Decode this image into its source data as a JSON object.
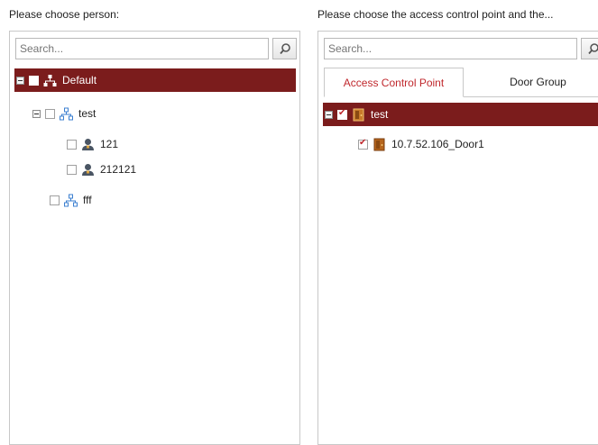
{
  "left": {
    "heading": "Please choose person:",
    "search_placeholder": "Search...",
    "tree": {
      "root_label": "Default",
      "group_label": "test",
      "persons": [
        "121",
        "212121"
      ],
      "group2_label": "fff"
    }
  },
  "right": {
    "heading": "Please choose the access control point and the...",
    "search_placeholder": "Search...",
    "tabs": {
      "active": "Access Control Point",
      "inactive": "Door Group"
    },
    "tree": {
      "root_label": "test",
      "door_label": "10.7.52.106_Door1"
    }
  },
  "colors": {
    "selected_bg": "#7b1c1c",
    "accent_red": "#c0282d",
    "group_icon": "#3b7fd0",
    "door_icon": "#b5651d"
  },
  "icons": [
    "search-icon",
    "org-icon",
    "person-icon",
    "door-icon",
    "collapse-icon"
  ]
}
